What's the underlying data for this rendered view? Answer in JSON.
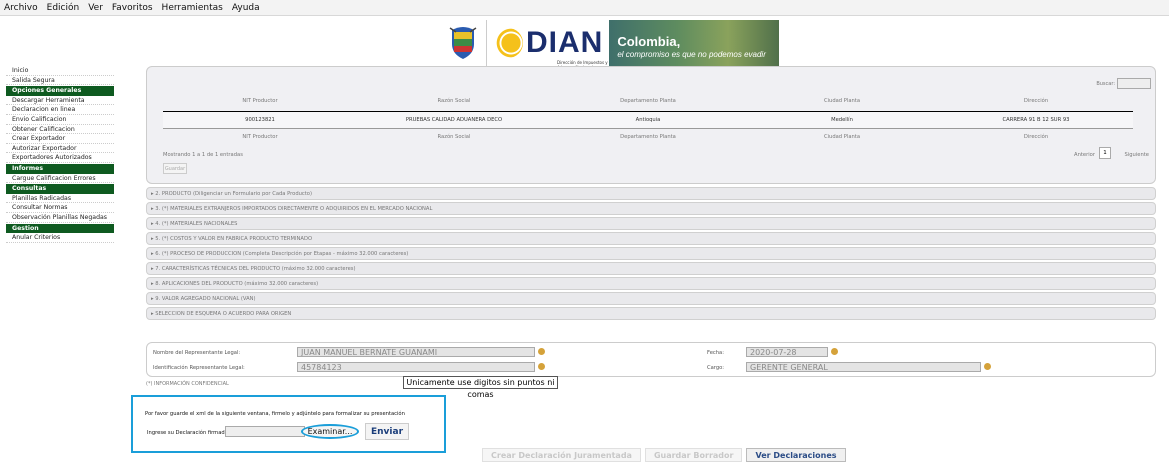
{
  "menubar": [
    "Archivo",
    "Edición",
    "Ver",
    "Favoritos",
    "Herramientas",
    "Ayuda"
  ],
  "banner": {
    "logo_text": "DIAN",
    "logo_sub": "Dirección de Impuestos y Aduanas Nacionales",
    "colombia": "Colombia,",
    "slogan": "el compromiso es que no podemos evadir"
  },
  "sidebar": {
    "top": [
      "Inicio",
      "Salida Segura"
    ],
    "groups": [
      {
        "title": "Opciones Generales",
        "items": [
          "Descargar Herramienta",
          "Declaracion en linea",
          "Envio Calificacion",
          "Obtener Calificacion",
          "Crear Exportador",
          "Autorizar Exportador",
          "Exportadores Autorizados"
        ]
      },
      {
        "title": "Informes",
        "items": [
          "Cargue Calificacion Errores"
        ]
      },
      {
        "title": "Consultas",
        "items": [
          "Planillas Radicadas",
          "Consultar Normas",
          "Observación Planillas Negadas"
        ]
      },
      {
        "title": "Gestion",
        "items": [
          "Anular Criterios"
        ]
      }
    ]
  },
  "table": {
    "buscar_label": "Buscar:",
    "headers": [
      "NIT Productor",
      "Razón Social",
      "Departamento Planta",
      "Ciudad Planta",
      "Dirección"
    ],
    "row": [
      "900123821",
      "PRUEBAS CALIDAD ADUANERA DECO",
      "Antioquia",
      "Medellín",
      "CARRERA 91 B 12 SUR 93"
    ],
    "showing": "Mostrando 1 a 1 de 1 entradas",
    "prev": "Anterior",
    "page": "1",
    "next": "Siguiente",
    "guardar": "Guardar"
  },
  "sections": [
    "▸ 2. PRODUCTO (Diligenciar un Formulario por Cada Producto)",
    "▸ 3. (*) MATERIALES EXTRANJEROS IMPORTADOS DIRECTAMENTE O ADQUIRIDOS EN EL MERCADO NACIONAL",
    "▸ 4. (*) MATERIALES NACIONALES",
    "▸ 5. (*) COSTOS Y VALOR EN FABRICA PRODUCTO TERMINADO",
    "▸ 6. (*) PROCESO DE PRODUCCION (Completa Descripción por Etapas - máximo 32.000 caracteres)",
    "▸ 7. CARACTERÍSTICAS TÉCNICAS DEL PRODUCTO (máximo 32.000 caracteres)",
    "▸ 8. APLICACIONES DEL PRODUCTO (máximo 32.000 caracteres)",
    "▸ 9. VALOR AGREGADO NACIONAL (VAN)",
    "▸ SELECCION DE ESQUEMA O ACUERDO PARA ORIGEN"
  ],
  "rep": {
    "name_label": "Nombre del Representante Legal:",
    "name_value": "JUAN MANUEL BERNATE GUANAMI",
    "id_label": "Identificación Representante Legal:",
    "id_value": "45784123",
    "date_label": "Fecha:",
    "date_value": "2020-07-28",
    "role_label": "Cargo:",
    "role_value": "GERENTE GENERAL"
  },
  "confidencial": "(*) INFORMACIÓN CONFIDENCIAL",
  "tooltip": "Unicamente use digitos sin puntos ni comas",
  "upload": {
    "instructions": "Por favor guarde el xml de la siguiente ventana, firmelo y adjúntelo para formalizar su presentación",
    "label": "Ingrese su Declaración firmada:",
    "browse": "Examinar...",
    "send": "Enviar"
  },
  "bottom": [
    "Crear Declaración Juramentada",
    "Guardar Borrador",
    "Ver Declaraciones"
  ]
}
